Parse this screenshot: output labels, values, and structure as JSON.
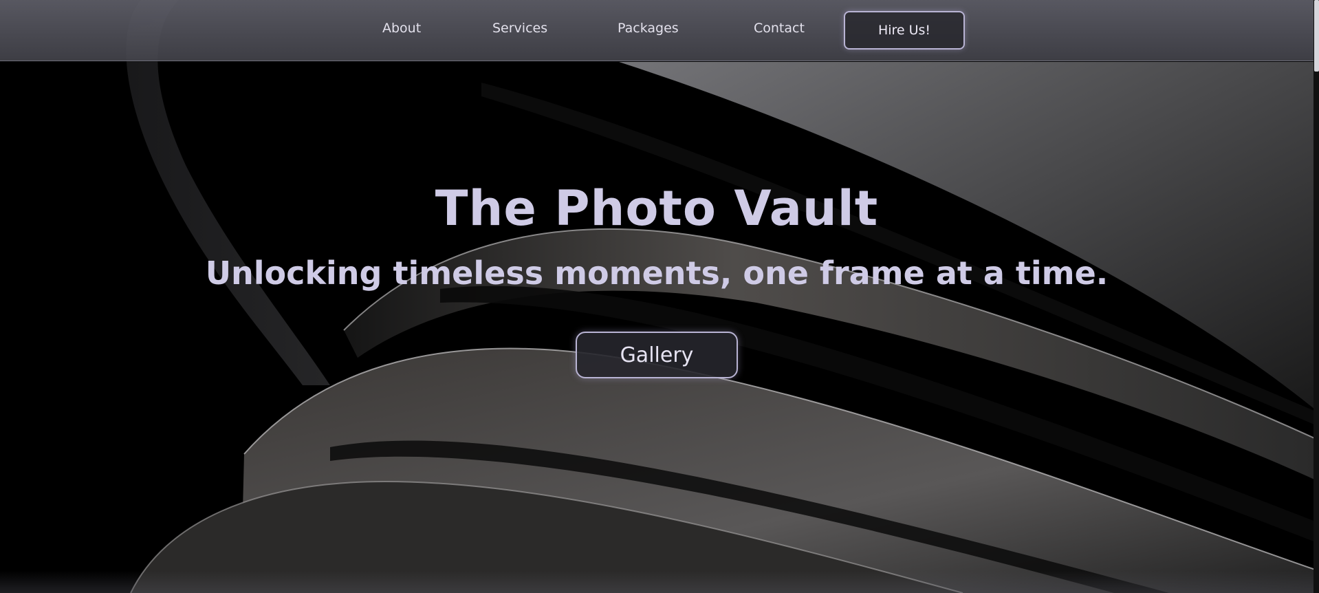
{
  "nav": {
    "items": [
      {
        "label": "About"
      },
      {
        "label": "Services"
      },
      {
        "label": "Packages"
      },
      {
        "label": "Contact"
      }
    ],
    "cta_label": "Hire Us!"
  },
  "hero": {
    "title": "The Photo Vault",
    "subtitle": "Unlocking timeless moments, one frame at a time.",
    "button_label": "Gallery"
  },
  "colors": {
    "accent_text": "#cfcbe6",
    "button_border": "#b9b4d4",
    "background": "#000000"
  },
  "icons": {
    "background": "abstract-dark-ribbons-image"
  }
}
